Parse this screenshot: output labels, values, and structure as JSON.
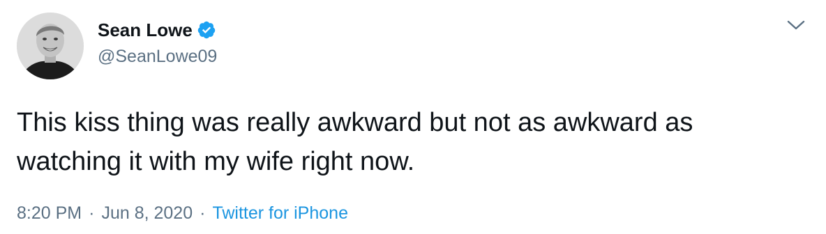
{
  "user": {
    "display_name": "Sean Lowe",
    "handle": "@SeanLowe09",
    "verified": true
  },
  "tweet": {
    "text": "This kiss thing was really awkward but not as awkward as\nwatching it with my wife right now.",
    "time": "8:20 PM",
    "separator": "·",
    "date": "Jun 8, 2020",
    "source": "Twitter for iPhone"
  },
  "colors": {
    "text": "#0f1419",
    "secondary": "#5b7083",
    "link": "#1b95e0",
    "verified": "#1da1f2"
  },
  "icons": {
    "verified": "verified-badge-icon",
    "menu": "chevron-down-icon"
  }
}
